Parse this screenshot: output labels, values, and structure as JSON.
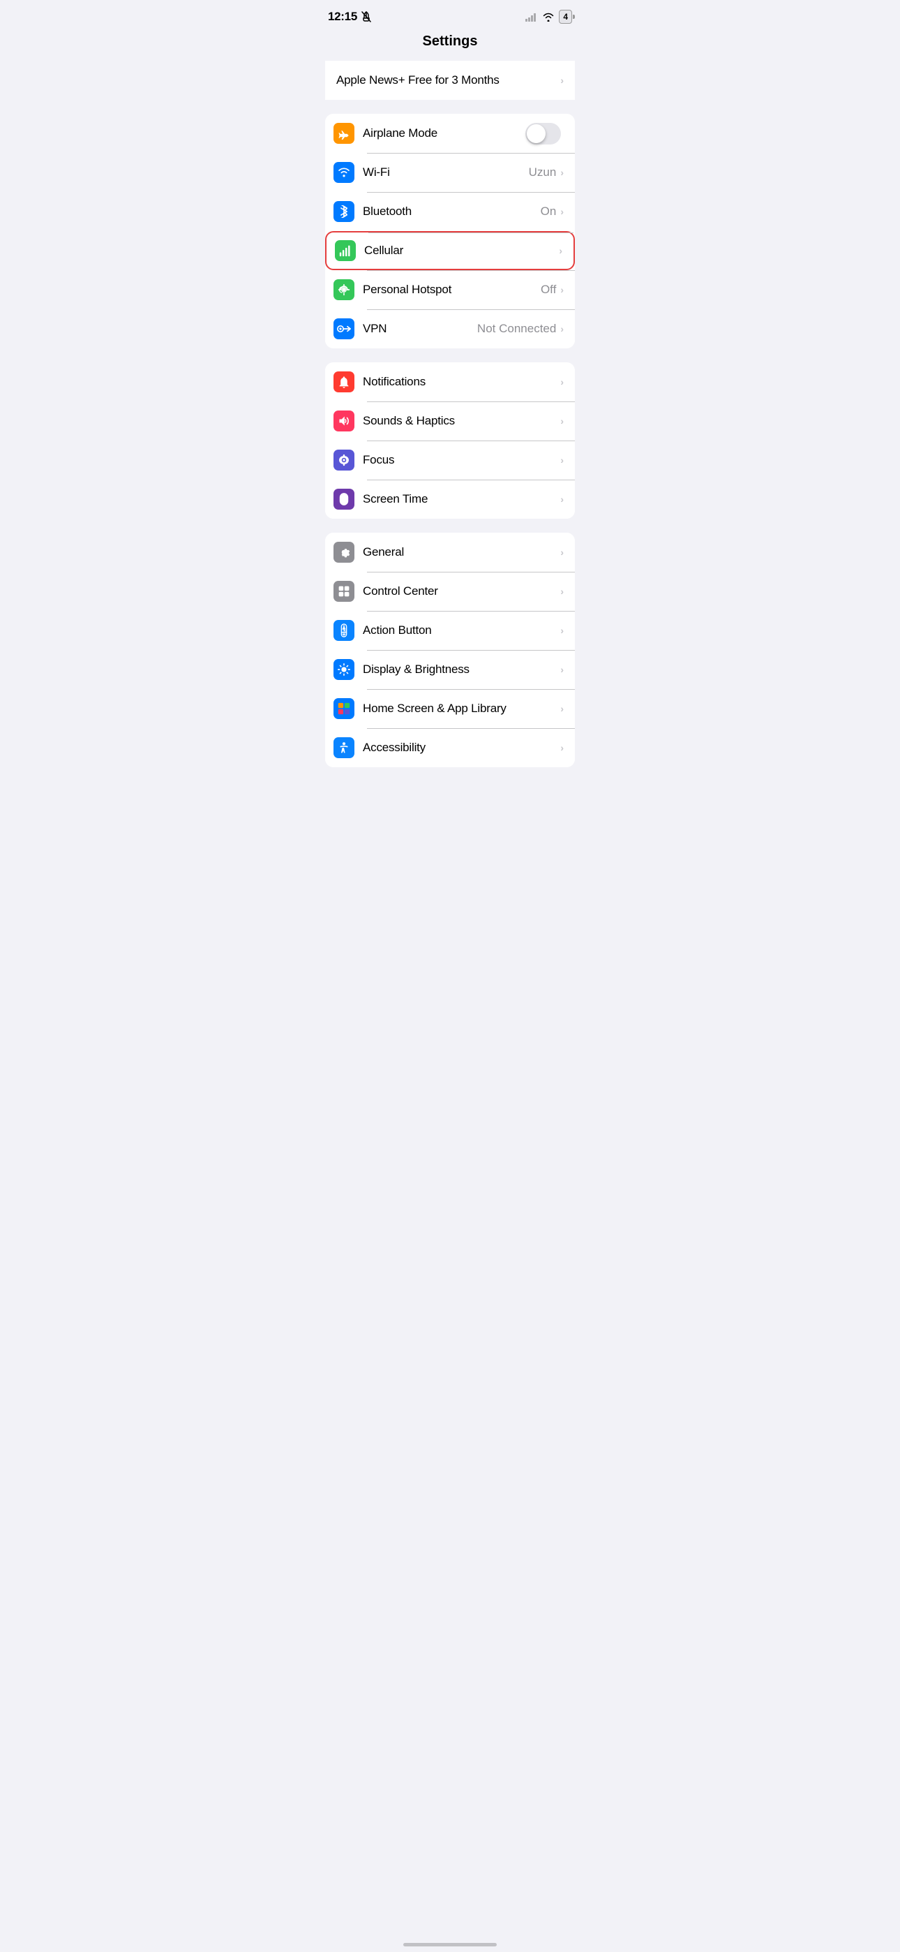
{
  "statusBar": {
    "time": "12:15",
    "battery": "4",
    "wifi": true,
    "mute": true
  },
  "pageTitle": "Settings",
  "promoSection": {
    "label": "Apple News+ Free for 3 Months"
  },
  "connectivitySection": [
    {
      "id": "airplane-mode",
      "label": "Airplane Mode",
      "type": "toggle",
      "toggleOn": false,
      "iconBg": "bg-orange",
      "icon": "airplane"
    },
    {
      "id": "wifi",
      "label": "Wi-Fi",
      "value": "Uzun",
      "type": "nav",
      "iconBg": "bg-blue",
      "icon": "wifi"
    },
    {
      "id": "bluetooth",
      "label": "Bluetooth",
      "value": "On",
      "type": "nav",
      "iconBg": "bg-blue",
      "icon": "bluetooth"
    },
    {
      "id": "cellular",
      "label": "Cellular",
      "value": "",
      "type": "nav",
      "iconBg": "bg-green",
      "icon": "cellular",
      "highlighted": true
    },
    {
      "id": "personal-hotspot",
      "label": "Personal Hotspot",
      "value": "Off",
      "type": "nav",
      "iconBg": "bg-green",
      "icon": "hotspot"
    },
    {
      "id": "vpn",
      "label": "VPN",
      "value": "Not Connected",
      "type": "nav",
      "iconBg": "bg-blue",
      "icon": "vpn"
    }
  ],
  "notificationsSection": [
    {
      "id": "notifications",
      "label": "Notifications",
      "type": "nav",
      "iconBg": "bg-red",
      "icon": "bell"
    },
    {
      "id": "sounds-haptics",
      "label": "Sounds & Haptics",
      "type": "nav",
      "iconBg": "bg-pink",
      "icon": "sound"
    },
    {
      "id": "focus",
      "label": "Focus",
      "type": "nav",
      "iconBg": "bg-purple",
      "icon": "moon"
    },
    {
      "id": "screen-time",
      "label": "Screen Time",
      "type": "nav",
      "iconBg": "bg-purple-dark",
      "icon": "hourglass"
    }
  ],
  "generalSection": [
    {
      "id": "general",
      "label": "General",
      "type": "nav",
      "iconBg": "bg-gray",
      "icon": "gear"
    },
    {
      "id": "control-center",
      "label": "Control Center",
      "type": "nav",
      "iconBg": "bg-gray",
      "icon": "sliders"
    },
    {
      "id": "action-button",
      "label": "Action Button",
      "type": "nav",
      "iconBg": "bg-blue-dark",
      "icon": "action"
    },
    {
      "id": "display-brightness",
      "label": "Display & Brightness",
      "type": "nav",
      "iconBg": "bg-blue",
      "icon": "brightness"
    },
    {
      "id": "home-screen",
      "label": "Home Screen & App Library",
      "type": "nav",
      "iconBg": "bg-blue",
      "icon": "homescreen"
    },
    {
      "id": "accessibility",
      "label": "Accessibility",
      "type": "nav",
      "iconBg": "bg-blue",
      "icon": "accessibility",
      "partial": true
    }
  ]
}
